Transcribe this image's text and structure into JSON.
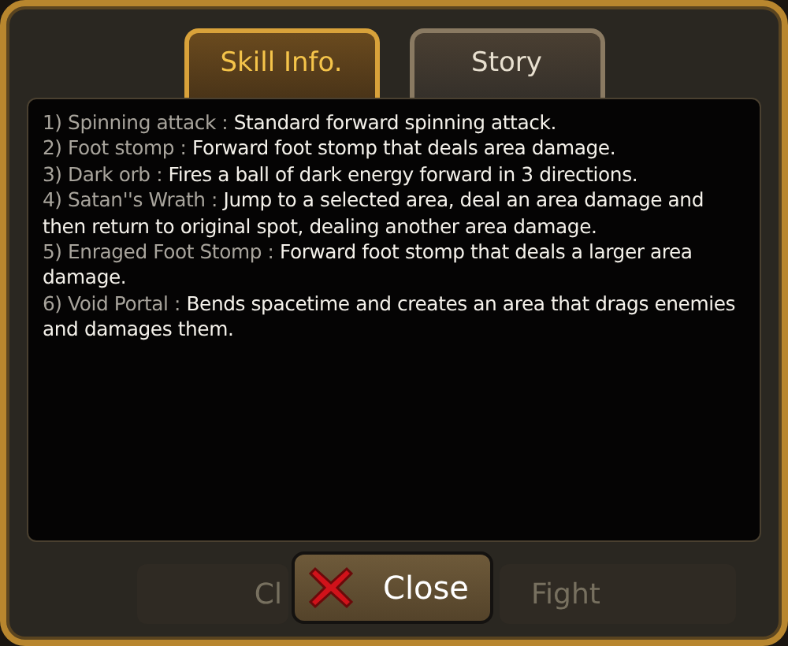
{
  "tabs": [
    {
      "label": "Skill Info.",
      "selected": true
    },
    {
      "label": "Story",
      "selected": false
    }
  ],
  "skills": [
    {
      "name": "1) Spinning attack :",
      "description": "Standard forward spinning attack."
    },
    {
      "name": "2) Foot stomp :",
      "description": "Forward foot stomp that deals area damage."
    },
    {
      "name": "3) Dark orb :",
      "description": "Fires a ball of dark energy forward in 3 directions."
    },
    {
      "name": "4) Satan''s Wrath :",
      "description": "Jump to a selected area, deal an area damage and then return to original spot, dealing another area damage."
    },
    {
      "name": "5) Enraged Foot Stomp :",
      "description": "Forward foot stomp that deals a larger area damage."
    },
    {
      "name": "6) Void Portal :",
      "description": "Bends spacetime and creates an area that drags enemies and damages them."
    }
  ],
  "background_buttons": [
    "Cl",
    "Fight"
  ],
  "close_button": {
    "label": "Close"
  }
}
